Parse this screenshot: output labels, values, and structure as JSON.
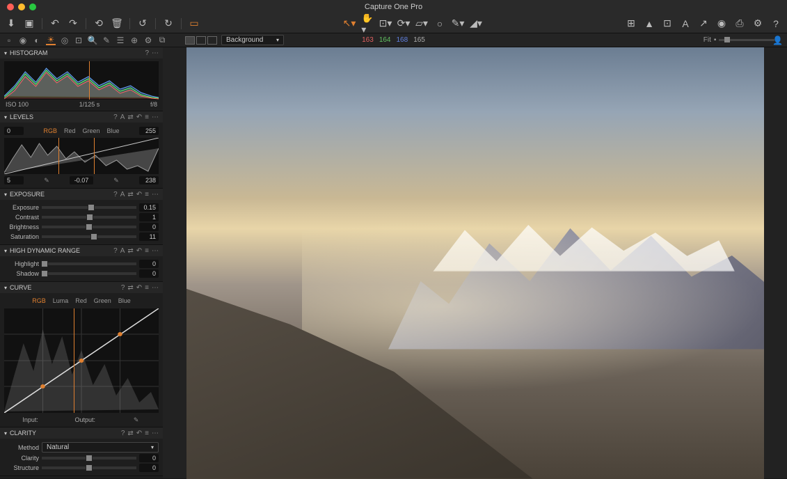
{
  "app": {
    "title": "Capture One Pro"
  },
  "toolbar": {
    "bg_select": "Background",
    "rgb": {
      "r": "163",
      "g": "164",
      "b": "168",
      "l": "165"
    },
    "fit_label": "Fit"
  },
  "panel_icons": {
    "help": "?",
    "auto": "A",
    "preset": "≡",
    "more": "⋯",
    "copy": "⇄",
    "reset": "↶"
  },
  "histogram": {
    "title": "HISTOGRAM",
    "iso": "ISO 100",
    "shutter": "1/125 s",
    "aperture": "f/8"
  },
  "levels": {
    "title": "LEVELS",
    "tabs": [
      "RGB",
      "Red",
      "Green",
      "Blue"
    ],
    "in_low": "0",
    "in_high": "255",
    "out_low": "5",
    "gamma": "-0.07",
    "out_high": "238"
  },
  "exposure": {
    "title": "EXPOSURE",
    "rows": [
      {
        "label": "Exposure",
        "value": "0.15",
        "pos": 52
      },
      {
        "label": "Contrast",
        "value": "1",
        "pos": 51
      },
      {
        "label": "Brightness",
        "value": "0",
        "pos": 50
      },
      {
        "label": "Saturation",
        "value": "11",
        "pos": 55
      }
    ]
  },
  "hdr": {
    "title": "HIGH DYNAMIC RANGE",
    "rows": [
      {
        "label": "Highlight",
        "value": "0",
        "pos": 3
      },
      {
        "label": "Shadow",
        "value": "0",
        "pos": 3
      }
    ]
  },
  "curve": {
    "title": "CURVE",
    "tabs": [
      "RGB",
      "Luma",
      "Red",
      "Green",
      "Blue"
    ],
    "input_label": "Input:",
    "output_label": "Output:"
  },
  "clarity": {
    "title": "CLARITY",
    "method_label": "Method",
    "method_value": "Natural",
    "rows": [
      {
        "label": "Clarity",
        "value": "0",
        "pos": 50
      },
      {
        "label": "Structure",
        "value": "0",
        "pos": 50
      }
    ]
  }
}
